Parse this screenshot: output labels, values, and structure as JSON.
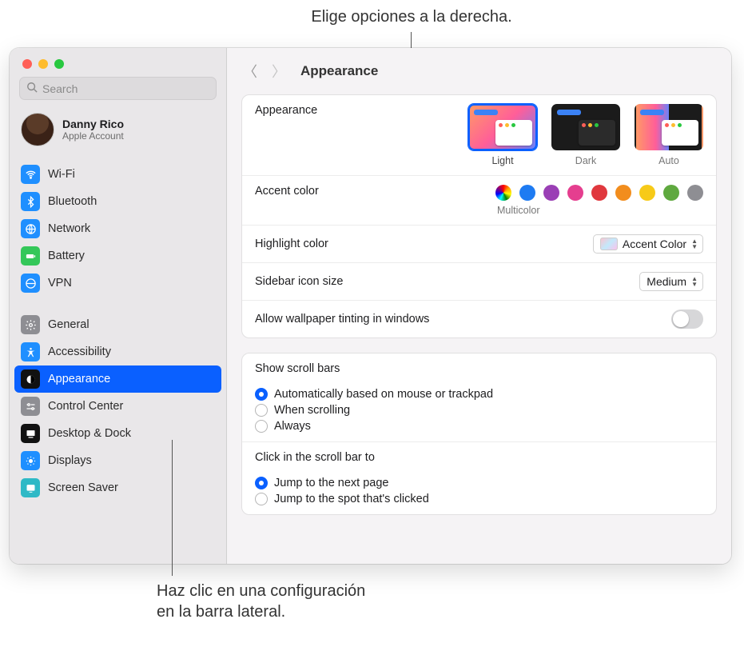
{
  "callouts": {
    "top": "Elige opciones a la derecha.",
    "bottom_l1": "Haz clic en una configuración",
    "bottom_l2": "en la barra lateral."
  },
  "search": {
    "placeholder": "Search"
  },
  "account": {
    "name": "Danny Rico",
    "sub": "Apple Account"
  },
  "sidebar": {
    "group1": [
      {
        "label": "Wi-Fi"
      },
      {
        "label": "Bluetooth"
      },
      {
        "label": "Network"
      },
      {
        "label": "Battery"
      },
      {
        "label": "VPN"
      }
    ],
    "group2": [
      {
        "label": "General"
      },
      {
        "label": "Accessibility"
      },
      {
        "label": "Appearance"
      },
      {
        "label": "Control Center"
      },
      {
        "label": "Desktop & Dock"
      },
      {
        "label": "Displays"
      },
      {
        "label": "Screen Saver"
      }
    ]
  },
  "header": {
    "title": "Appearance"
  },
  "appearance": {
    "label": "Appearance",
    "options": {
      "light": "Light",
      "dark": "Dark",
      "auto": "Auto"
    },
    "selected": "light"
  },
  "accent": {
    "label": "Accent color",
    "selected_caption": "Multicolor",
    "colors": [
      "multi",
      "blue",
      "purple",
      "pink",
      "red",
      "orange",
      "yellow",
      "green",
      "gray"
    ]
  },
  "highlight": {
    "label": "Highlight color",
    "value": "Accent Color"
  },
  "sidebar_icon": {
    "label": "Sidebar icon size",
    "value": "Medium"
  },
  "wallpaper_tint": {
    "label": "Allow wallpaper tinting in windows",
    "value": false
  },
  "scrollbars": {
    "label": "Show scroll bars",
    "o1": "Automatically based on mouse or trackpad",
    "o2": "When scrolling",
    "o3": "Always",
    "selected": "o1"
  },
  "click_scroll": {
    "label": "Click in the scroll bar to",
    "o1": "Jump to the next page",
    "o2": "Jump to the spot that's clicked",
    "selected": "o1"
  }
}
